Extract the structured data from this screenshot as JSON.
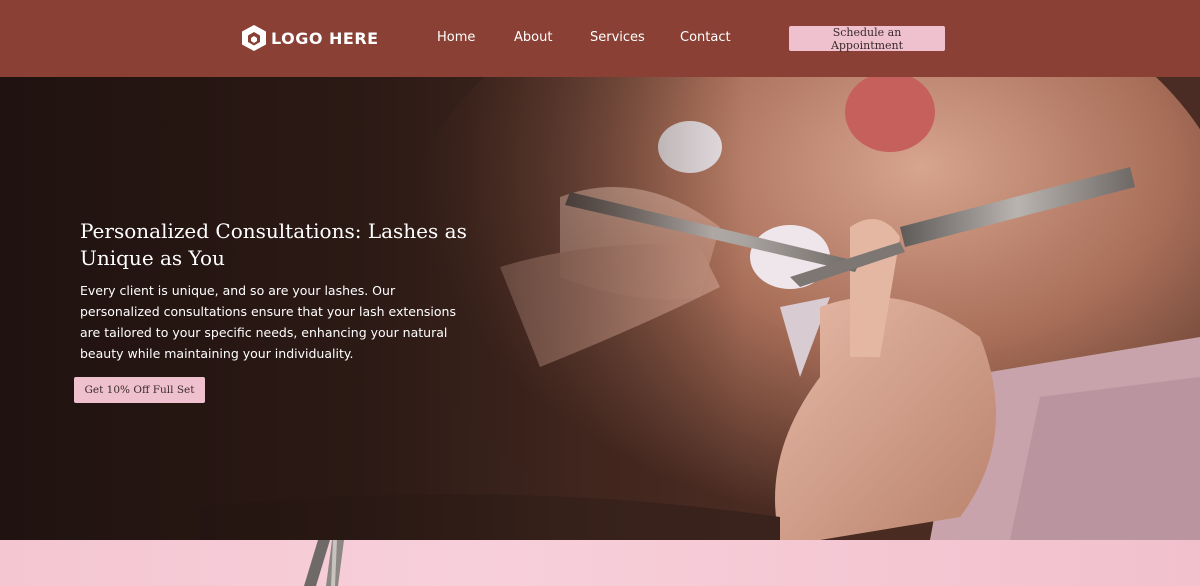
{
  "header": {
    "logo_text": "LOGO HERE",
    "nav": {
      "home": "Home",
      "about": "About",
      "services": "Services",
      "contact": "Contact"
    },
    "cta_label": "Schedule an Appointment"
  },
  "hero": {
    "title": "Personalized Consultations: Lashes as Unique as You",
    "body": "Every client is unique, and so are your lashes. Our personalized consultations ensure that your lash extensions are tailored to your specific needs, enhancing your natural beauty while maintaining your individuality.",
    "button_label": "Get 10% Off Full Set",
    "image_subject": "lash-extension-application-photo"
  },
  "colors": {
    "header_bg": "#8a4034",
    "button_bg": "#efc1cf",
    "accent_pink": "#f4c6d2"
  }
}
